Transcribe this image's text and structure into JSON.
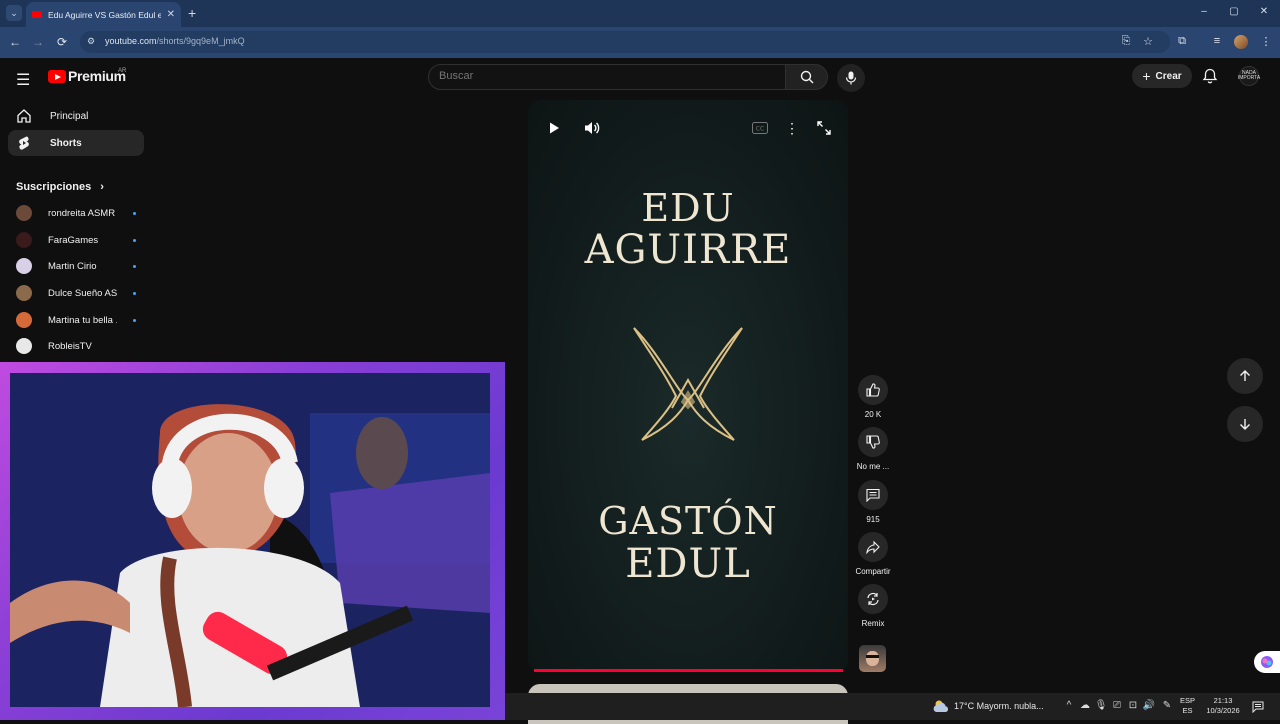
{
  "browser": {
    "tab_title": "Edu Aguirre VS Gastón Edul en",
    "url_host": "youtube.com",
    "url_path": "/shorts/9gq9eM_jmkQ",
    "window_controls": [
      "–",
      "▢",
      "✕"
    ]
  },
  "youtube": {
    "brand": "Premium",
    "country": "AR",
    "search_placeholder": "Buscar",
    "create_label": "Crear",
    "channel_avatar_text": "NADA IMPORTA"
  },
  "sidebar": {
    "items": [
      {
        "label": "Principal",
        "icon": "home-icon"
      },
      {
        "label": "Shorts",
        "icon": "shorts-icon",
        "active": true
      }
    ],
    "subscriptions_title": "Suscripciones",
    "subscriptions": [
      {
        "name": "rondreita ASMR",
        "color": "#6b4a3a"
      },
      {
        "name": "FaraGames",
        "color": "#3a1a1a"
      },
      {
        "name": "Martin Cirio",
        "color": "#d8d0e6"
      },
      {
        "name": "Dulce Sueño AS...",
        "color": "#8a6a4a"
      },
      {
        "name": "Martina tu bella ...",
        "color": "#d46a3a"
      },
      {
        "name": "RobleisTV",
        "color": "#e8e8e8"
      }
    ]
  },
  "short": {
    "title_top": [
      "EDU",
      "AGUIRRE"
    ],
    "title_bottom": [
      "GASTÓN",
      "EDUL"
    ],
    "accent_color": "#e8c98a",
    "progress_color": "#ff0033"
  },
  "actions": {
    "likes": "20 K",
    "dislike_label": "No me ...",
    "comments": "915",
    "share_label": "Compartir",
    "remix_label": "Remix"
  },
  "taskbar": {
    "weather": "17°C  Mayorm. nubla...",
    "lang_top": "ESP",
    "lang_bottom": "ES",
    "time": "21:13",
    "date": "10/3/2026"
  }
}
